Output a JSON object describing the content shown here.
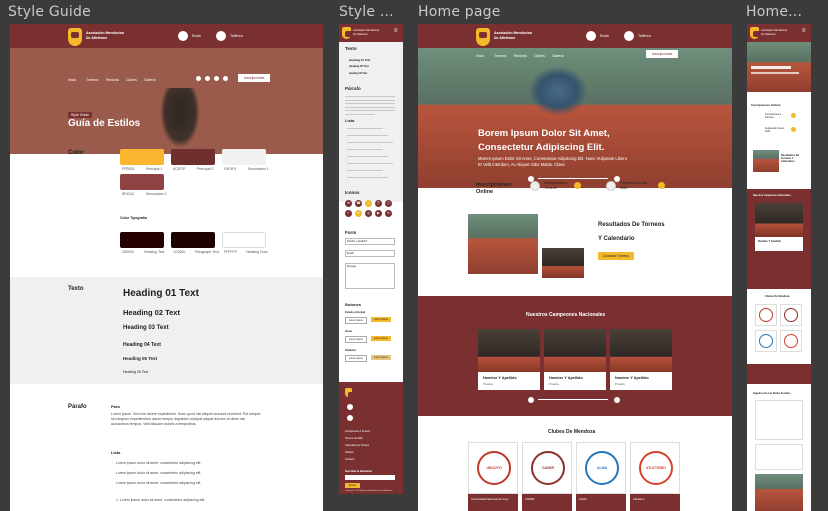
{
  "frames": {
    "style_guide": "Style Guide",
    "style_mobile": "Style ...",
    "home_page": "Home page",
    "home_mobile": "Home..."
  },
  "header": {
    "org_name_line1": "Asociación Mendocina",
    "org_name_line2": "De Atletismo",
    "contact1": "Email",
    "contact2": "Teléfono",
    "nav": [
      "Inicio",
      "Torneos",
      "Récords",
      "Clubes",
      "Galería"
    ],
    "cta": "Inscripciones"
  },
  "style_guide": {
    "hero_badge": "Style Guide",
    "hero_title": "Guía de Estilos",
    "color_heading": "Color",
    "swatches": [
      {
        "hex": "FFB534",
        "name": "Principal 1",
        "color": "#fbb62f"
      },
      {
        "hex": "6C2F2F",
        "name": "Principal 2",
        "color": "#6f2f2f"
      },
      {
        "hex": "F4F4F4",
        "name": "Secundario 1",
        "color": "#f1f1f1"
      },
      {
        "hex": "8F4242",
        "name": "Secundario 2",
        "color": "#8f4242"
      }
    ],
    "typo_color_heading": "Color Tipografía",
    "typo_swatches": [
      {
        "hex": "260000",
        "name": "Heading Text",
        "color": "#260000"
      },
      {
        "hex": "1C0000",
        "name": "Paragraph Text",
        "color": "#1c0000"
      },
      {
        "hex": "FFFFFF",
        "name": "Heading Cont.",
        "color": "#ffffff"
      }
    ],
    "text_heading": "Texto",
    "headings": [
      "Heading 01 Text",
      "Heading 02 Text",
      "Heading 03 Text",
      "Heading 04 Text",
      "Heading 05 Text",
      "Heading 06 Text"
    ],
    "para_heading": "Párafo",
    "para_title": "Para",
    "para_body": "Lorem ipsum. Sed non facere expedientur. Nunc quod nisi aliquet nesciunt recubent. Est semper sit integrum expediendum ipsum tempor dignissim volutpat aliquet dolores id ullam nisi accusamus tempus. Velit aliquam doloris a temporibus.",
    "list_heading": "Lista",
    "list_items": [
      "Lorem ipsum dolor sit amet, consectetur adipiscing elit.",
      "Lorem ipsum dolor sit amet, consectetur adipiscing elit.",
      "Lorem ipsum dolor sit amet, consectetur adipiscing elit."
    ],
    "numbered_item": "1. Lorem ipsum dolor sit amet, consectetur adipiscing elit."
  },
  "style_mobile": {
    "texto": "Texto",
    "h_samples": [
      "Heading 01 Text",
      "Heading 02 Text",
      "Heading 03 Text"
    ],
    "parrafo": "Párrafo",
    "lista": "Lista",
    "iconos": "Iconos",
    "form": "Form",
    "form_fields": [
      "Nombre y Apellido*",
      "Email*",
      "Mensaje"
    ],
    "botones": "Botones",
    "btn_groups": [
      "Estado principal",
      "Hover",
      "Disabled"
    ],
    "btn_label": "Lorem Ipsum",
    "footer_links": [
      "Inscripciones a Torneos",
      "Torneos de AMA",
      "Calendario de Torneos",
      "Noticias",
      "Contacto"
    ],
    "newsletter": "Suscribite al Newsletter",
    "newsletter_btn": "Enviar",
    "copyright": "Copyright © 2023 Asociación Mendocina de Atletismo"
  },
  "home": {
    "hero_title_line1": "Borem Ipsum Dolor Sit Amet,",
    "hero_title_line2": "Consectetur Adipiscing Elit.",
    "hero_sub_line1": "Morem Ipsum Dolor Sit Amet, Consectetur Adipiscing Elit. Nunc Vulputate Libero",
    "hero_sub_line2": "Et Velit Interdum, Ac Aliquet Odio Mattis. Class",
    "inscripciones_label": "Inscripciones Online",
    "inscripciones_items": [
      "Inscripciones a Torneos",
      "Federación Anual AMA"
    ],
    "resultados_title_line1": "Resultados De Torneos",
    "resultados_title_line2": "Y Calendario",
    "resultados_btn": "Consultar Torneos",
    "campeones_title": "Nuestros Campeones Nacionales",
    "champions": [
      {
        "name": "Nombre Y Apellido",
        "event": "Prueba"
      },
      {
        "name": "Nombre Y Apellido",
        "event": "Prueba"
      },
      {
        "name": "Nombre Y Apellido",
        "event": "Prueba"
      }
    ],
    "clubes_title": "Clubes De Mendoza",
    "clubs": [
      {
        "name": "Universidad Nacional de Cuyo",
        "badge": "UNCUYO"
      },
      {
        "name": "CAVER",
        "badge": "CAVER"
      },
      {
        "name": "ALMA",
        "badge": "ALMA"
      },
      {
        "name": "Atletismo",
        "badge": "ATLETISMO"
      }
    ]
  },
  "home_mobile": {
    "inscripciones_label": "Inscripciones Online",
    "items": [
      "Inscripciones a Torneos",
      "Federación Anual AMA"
    ],
    "resultados": "Resultados De Torneos Y Calendario",
    "campeones": "Nuestros Campeones Nacionales",
    "clubes": "Clubes De Mendoza",
    "champion_name": "Nombre Y Apellido",
    "redes": "Seguinos En Las Redes Sociales"
  },
  "colors": {
    "maroon": "#7a2f31",
    "accent": "#f4b82a",
    "canvas": "#3b3b3b"
  }
}
